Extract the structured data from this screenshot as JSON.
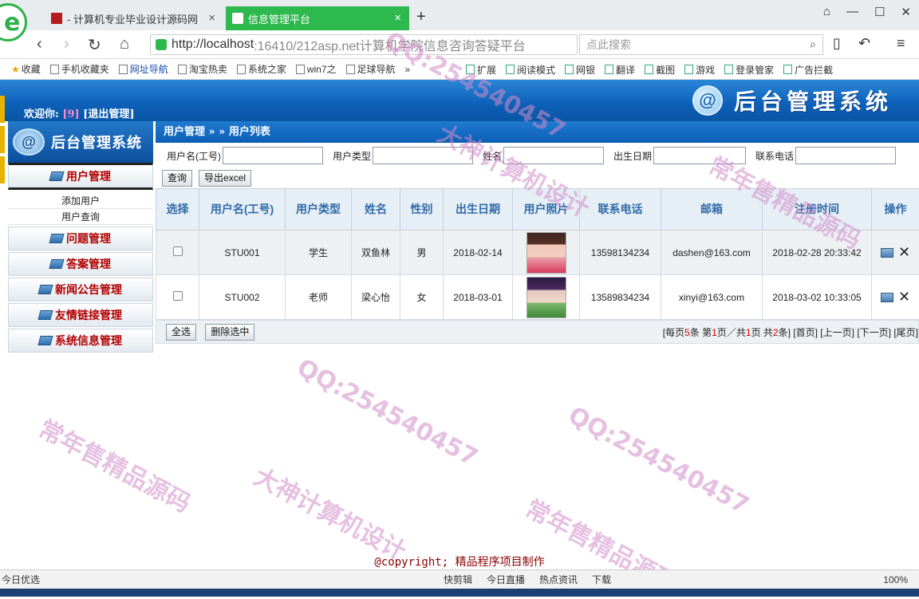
{
  "browser": {
    "tabs": [
      {
        "title": "- 计算机专业毕业设计源码网",
        "close": "×"
      },
      {
        "title": "信息管理平台",
        "close": "×"
      }
    ],
    "new_tab": "+",
    "url_host": "http://localhost",
    "url_rest": ":16410/212asp.net计算机学院信息咨询答疑平台",
    "search_placeholder": "点此搜索",
    "bookmarks": [
      "收藏",
      "手机收藏夹",
      "网址导航",
      "淘宝热卖",
      "系统之家",
      "win7之",
      "足球导航",
      "»"
    ],
    "bookmarks_right": [
      "扩展",
      "阅读模式",
      "网银",
      "翻译",
      "截图",
      "游戏",
      "登录管家",
      "广告拦截"
    ]
  },
  "header": {
    "welcome_label": "欢迎你:",
    "user_name": "[9]",
    "logout": "[退出管理]",
    "system_title": "后台管理系统"
  },
  "sidebar": {
    "logo_text": "后台管理系统",
    "active_menu": "用户管理",
    "sub_items": [
      "添加用户",
      "用户查询"
    ],
    "menus": [
      "问题管理",
      "答案管理",
      "新闻公告管理",
      "友情链接管理",
      "系统信息管理"
    ]
  },
  "main": {
    "breadcrumb": "用户管理 » » 用户列表",
    "filters": [
      {
        "label": "用户名(工号)",
        "value": ""
      },
      {
        "label": "用户类型",
        "value": ""
      },
      {
        "label": "姓名",
        "value": ""
      },
      {
        "label": "出生日期",
        "value": ""
      },
      {
        "label": "联系电话",
        "value": ""
      }
    ],
    "query_button": "查询",
    "export_button": "导出excel",
    "columns": [
      "选择",
      "用户名(工号)",
      "用户类型",
      "姓名",
      "性别",
      "出生日期",
      "用户照片",
      "联系电话",
      "邮箱",
      "注册时间",
      "操作"
    ],
    "rows": [
      {
        "username": "STU001",
        "type": "学生",
        "name": "双鱼林",
        "gender": "男",
        "birth": "2018-02-14",
        "phone": "13598134234",
        "email": "dashen@163.com",
        "reg_time": "2018-02-28 20:33:42"
      },
      {
        "username": "STU002",
        "type": "老师",
        "name": "梁心怡",
        "gender": "女",
        "birth": "2018-03-01",
        "phone": "13589834234",
        "email": "xinyi@163.com",
        "reg_time": "2018-03-02 10:33:05"
      }
    ],
    "select_all_button": "全选",
    "delete_selected_button": "删除选中",
    "pager": {
      "p1": "[每页",
      "per_page": "5",
      "p2": "条 第",
      "current": "1",
      "p3": "页／共",
      "total_pages": "1",
      "p4": "页 共",
      "total": "2",
      "p5": "条]",
      "first": "[首页]",
      "prev": "[上一页]",
      "next": "[下一页]",
      "last": "[尾页]"
    }
  },
  "footer": {
    "copyright": "@copyright; 精品程序项目制作"
  },
  "statusbar": {
    "left": "今日优选",
    "items": [
      "快剪辑",
      "今日直播",
      "热点资讯",
      "下载"
    ],
    "zoom": "100%"
  },
  "watermarks": {
    "qq": "QQ:254540457",
    "a": "大神计算机设计",
    "b": "常年售精品源码"
  },
  "colors": {
    "header_blue": "#0d5fb8",
    "tab_green": "#2db94d",
    "menu_red": "#b00000",
    "th_blue": "#2f6aa8"
  }
}
